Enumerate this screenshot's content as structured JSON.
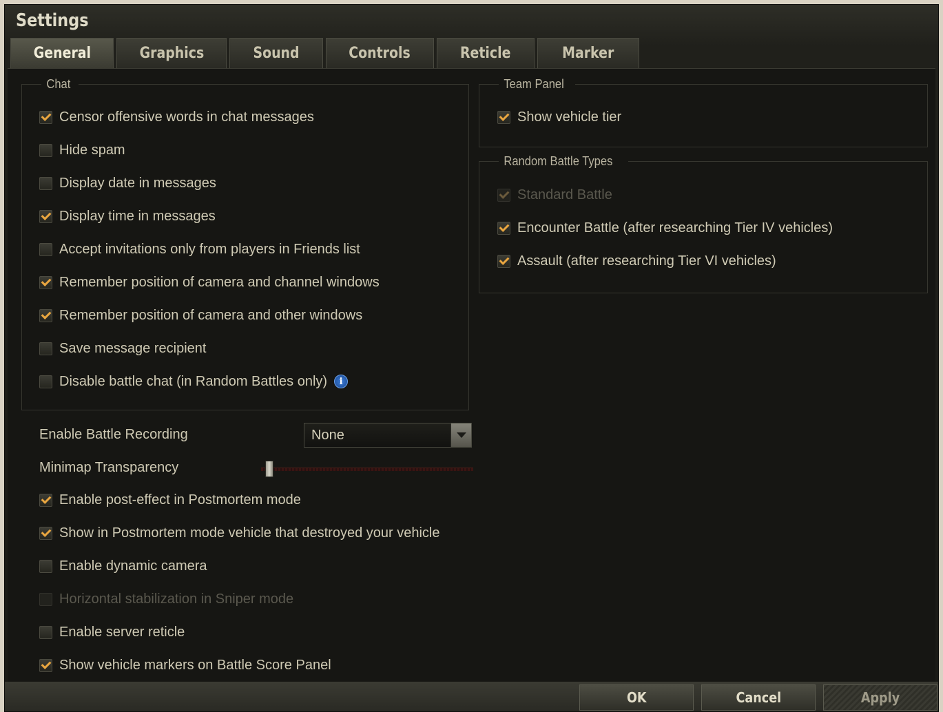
{
  "window": {
    "title": "Settings"
  },
  "tabs": [
    {
      "label": "General",
      "active": true
    },
    {
      "label": "Graphics",
      "active": false
    },
    {
      "label": "Sound",
      "active": false
    },
    {
      "label": "Controls",
      "active": false
    },
    {
      "label": "Reticle",
      "active": false
    },
    {
      "label": "Marker",
      "active": false
    }
  ],
  "chat": {
    "legend": "Chat",
    "options": [
      {
        "label": "Censor offensive words in chat messages",
        "checked": true
      },
      {
        "label": "Hide spam",
        "checked": false
      },
      {
        "label": "Display date in messages",
        "checked": false
      },
      {
        "label": "Display time in messages",
        "checked": true
      },
      {
        "label": "Accept invitations only from players in Friends list",
        "checked": false
      },
      {
        "label": "Remember position of camera and channel windows",
        "checked": true
      },
      {
        "label": "Remember position of camera and other windows",
        "checked": true
      },
      {
        "label": "Save message recipient",
        "checked": false
      },
      {
        "label": "Disable battle chat (in Random Battles only)",
        "checked": false,
        "info_icon": "info-icon"
      }
    ]
  },
  "recording": {
    "label": "Enable Battle Recording",
    "value": "None"
  },
  "minimap": {
    "label": "Minimap Transparency",
    "value_fraction": 0.04
  },
  "general_options": [
    {
      "label": "Enable post-effect in Postmortem mode",
      "checked": true,
      "disabled": false
    },
    {
      "label": "Show in Postmortem mode vehicle that destroyed your vehicle",
      "checked": true,
      "disabled": false
    },
    {
      "label": "Enable dynamic camera",
      "checked": false,
      "disabled": false
    },
    {
      "label": "Horizontal stabilization in Sniper mode",
      "checked": false,
      "disabled": true
    },
    {
      "label": "Enable server reticle",
      "checked": false,
      "disabled": false
    },
    {
      "label": "Show vehicle markers on Battle Score Panel",
      "checked": true,
      "disabled": false
    }
  ],
  "team_panel": {
    "legend": "Team Panel",
    "options": [
      {
        "label": "Show vehicle tier",
        "checked": true
      }
    ]
  },
  "battle_types": {
    "legend": "Random Battle Types",
    "options": [
      {
        "label": "Standard Battle",
        "checked": true,
        "disabled": true
      },
      {
        "label": "Encounter Battle (after researching Tier IV vehicles)",
        "checked": true,
        "disabled": false
      },
      {
        "label": "Assault (after researching Tier VI vehicles)",
        "checked": true,
        "disabled": false
      }
    ]
  },
  "buttons": {
    "ok": "OK",
    "cancel": "Cancel",
    "apply": "Apply"
  },
  "colors": {
    "accent_check": "#e9a640",
    "text": "#cfcab4",
    "background": "#161613"
  }
}
